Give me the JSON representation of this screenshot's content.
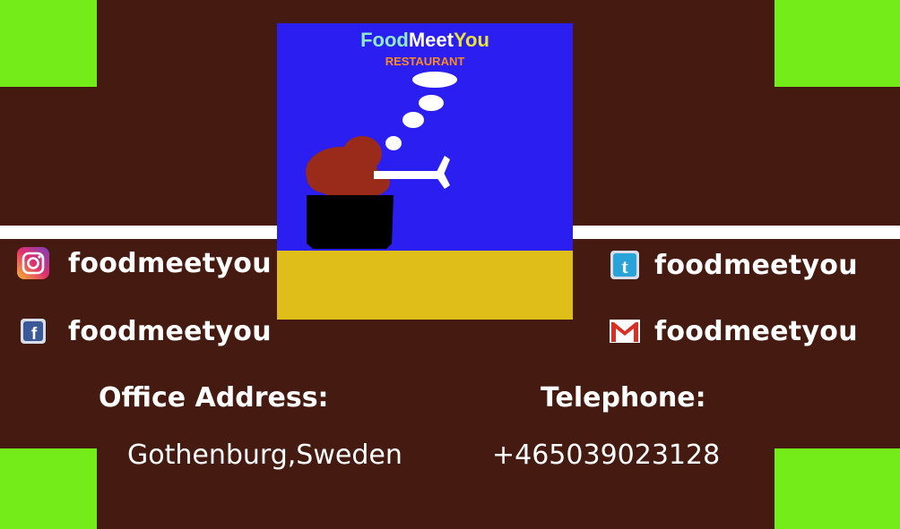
{
  "colors": {
    "background": "#451a10",
    "corner_accent": "#73ec1a",
    "logo_background": "#2a1ff0",
    "logo_ground": "#dfbe1a",
    "text": "#ffffff"
  },
  "logo": {
    "brand_part1": "Food",
    "brand_part2": "Meet",
    "brand_part3": "You",
    "subtitle": "RESTAURANT"
  },
  "social": {
    "instagram": {
      "icon": "instagram-icon",
      "handle": "foodmeetyou"
    },
    "facebook": {
      "icon": "facebook-icon",
      "handle": "foodmeetyou"
    },
    "twitter": {
      "icon": "twitter-icon",
      "handle": "foodmeetyou"
    },
    "gmail": {
      "icon": "gmail-icon",
      "handle": "foodmeetyou"
    }
  },
  "contact": {
    "office_label": "Office Address:",
    "office_value": "Gothenburg,Sweden",
    "telephone_label": "Telephone:",
    "telephone_value": "+465039023128"
  }
}
